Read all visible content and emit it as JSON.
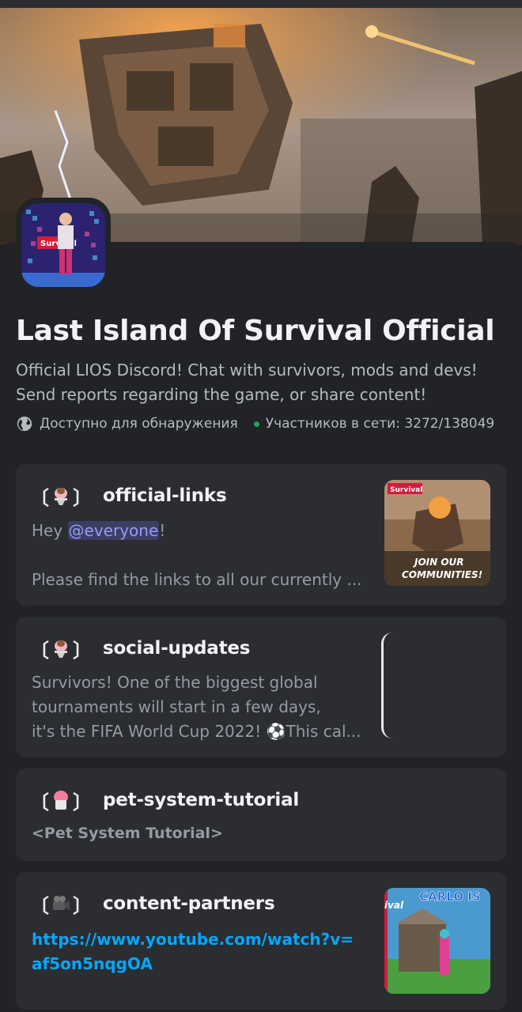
{
  "server": {
    "name": "Last Island Of Survival Official",
    "description": "Official LIOS Discord! Chat with survivors, mods and devs! Send reports regarding the game, or share content!",
    "discoverable": "Доступно для обнаружения",
    "online": "Участников в сети: 3272/138049"
  },
  "channels": [
    {
      "bracket_left": "〔",
      "bracket_right": "〕",
      "emoji_icon": "ice-cream-icon",
      "name": "official-links",
      "preview_line1_prefix": "Hey ",
      "preview_mention": "@everyone",
      "preview_line1_suffix": "!",
      "preview_line2": "Please find the links to all our currently ...",
      "thumb_text_top": "Survival",
      "thumb_text_bottom_1": "JOIN OUR",
      "thumb_text_bottom_2": "COMMUNITIES!"
    },
    {
      "bracket_left": "〔",
      "bracket_right": "〕",
      "emoji_icon": "ice-cream-icon",
      "name": "social-updates",
      "preview_lines": [
        "Survivors! One of the biggest global",
        "tournaments will start in a few days,",
        "it's the FIFA World Cup 2022! ⚽This cal..."
      ]
    },
    {
      "bracket_left": "〔",
      "bracket_right": "〕",
      "emoji_icon": "shaved-ice-icon",
      "name": "pet-system-tutorial",
      "preview_lines": [
        "<Pet System Tutorial>"
      ]
    },
    {
      "bracket_left": "〔",
      "bracket_right": "〕",
      "emoji_icon": "movie-camera-icon",
      "name": "content-partners",
      "link_lines": [
        "https://www.youtube.com/watch?v=",
        "af5on5nqgOA"
      ],
      "thumb_text_top": "CARLO IS",
      "thumb_text_left": "ival"
    }
  ],
  "colors": {
    "background": "#1e1f22",
    "card": "#2b2d31",
    "link": "#00a8fc",
    "mention": "#949cf7",
    "online_dot": "#23a55a"
  }
}
